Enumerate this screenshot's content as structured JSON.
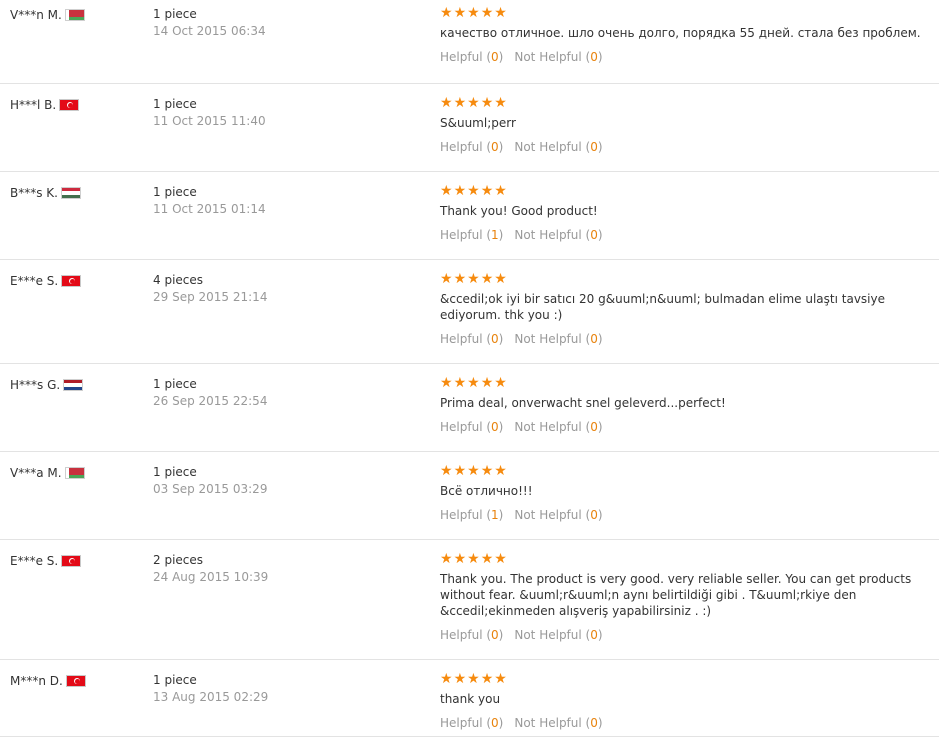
{
  "colors": {
    "star": "#f68b0f",
    "count": "#e8830d",
    "muted": "#999999",
    "divider": "#e3e3e3"
  },
  "vote_labels": {
    "helpful": "Helpful",
    "not_helpful": "Not Helpful"
  },
  "reviews": [
    {
      "buyer": "V***n M.",
      "flag": "by",
      "qty": "1 piece",
      "date": "14 Oct 2015 06:34",
      "rating": 5,
      "text": "качество отличное. шло очень долго, порядка 55 дней. стала без проблем.",
      "helpful": "0",
      "not_helpful": "0"
    },
    {
      "buyer": "H***l B.",
      "flag": "tr",
      "qty": "1 piece",
      "date": "11 Oct 2015 11:40",
      "rating": 5,
      "text": "S&uuml;perr",
      "helpful": "0",
      "not_helpful": "0"
    },
    {
      "buyer": "B***s K.",
      "flag": "hu",
      "qty": "1 piece",
      "date": "11 Oct 2015 01:14",
      "rating": 5,
      "text": "Thank you! Good product!",
      "helpful": "1",
      "not_helpful": "0"
    },
    {
      "buyer": "E***e S.",
      "flag": "tr",
      "qty": "4 pieces",
      "date": "29 Sep 2015 21:14",
      "rating": 5,
      "text": "&ccedil;ok iyi bir satıcı 20 g&uuml;n&uuml; bulmadan elime ulaştı tavsiye ediyorum. thk you :)",
      "helpful": "0",
      "not_helpful": "0"
    },
    {
      "buyer": "H***s G.",
      "flag": "nl",
      "qty": "1 piece",
      "date": "26 Sep 2015 22:54",
      "rating": 5,
      "text": "Prima deal, onverwacht snel geleverd...perfect!",
      "helpful": "0",
      "not_helpful": "0"
    },
    {
      "buyer": "V***a M.",
      "flag": "by",
      "qty": "1 piece",
      "date": "03 Sep 2015 03:29",
      "rating": 5,
      "text": "Всё отлично!!!",
      "helpful": "1",
      "not_helpful": "0"
    },
    {
      "buyer": "E***e S.",
      "flag": "tr",
      "qty": "2 pieces",
      "date": "24 Aug 2015 10:39",
      "rating": 5,
      "text": "Thank you. The product is very good. very reliable seller. You can get products without fear. &uuml;r&uuml;n aynı belirtildiği gibi . T&uuml;rkiye den &ccedil;ekinmeden alışveriş yapabilirsiniz . :)",
      "helpful": "0",
      "not_helpful": "0"
    },
    {
      "buyer": "M***n D.",
      "flag": "tr",
      "qty": "1 piece",
      "date": "13 Aug 2015 02:29",
      "rating": 5,
      "text": "thank you",
      "helpful": "0",
      "not_helpful": "0"
    }
  ]
}
